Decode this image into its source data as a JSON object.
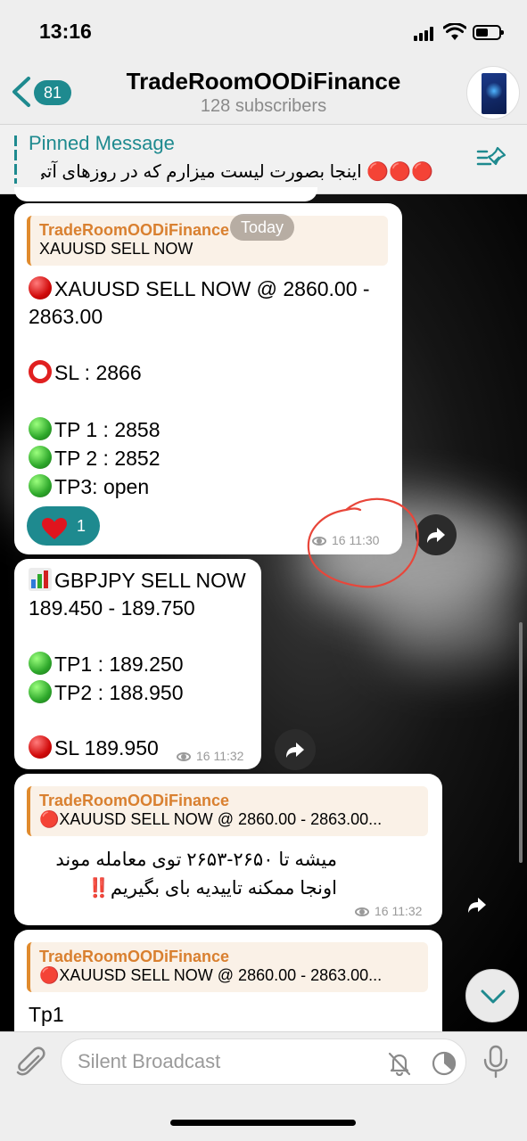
{
  "status_bar": {
    "time": "13:16"
  },
  "header": {
    "back_count": "81",
    "channel_title": "TradeRoomOODiFinance",
    "subscribers": "128 subscribers"
  },
  "pinned": {
    "title": "Pinned Message",
    "text": "🔴🔴🔴 اینجا بصورت لیست میزارم که در روزهای آتی"
  },
  "date_pill": "Today",
  "messages": [
    {
      "reply_name": "TradeRoomOODiFinance",
      "reply_text": "XAUUSD SELL NOW",
      "lines": [
        "XAUUSD SELL NOW @ 2860.00 -",
        "2863.00",
        "SL : 2866",
        "TP 1 : 2858",
        "TP 2 : 2852",
        "TP3: open"
      ],
      "reaction_count": "1",
      "meta": "16 11:30"
    },
    {
      "lines": [
        "GBPJPY SELL NOW",
        "189.450 - 189.750",
        "TP1 : 189.250",
        "TP2 : 188.950",
        "SL 189.950"
      ],
      "meta": "16 11:32"
    },
    {
      "reply_name": "TradeRoomOODiFinance",
      "reply_text": "🔴XAUUSD SELL NOW @ 2860.00 - 2863.00...",
      "lines": [
        "میشه تا ۲۶۵۰-۲۶۵۳ توی معامله موند",
        "اونجا ممکنه تاییدیه بای بگیریم‼️"
      ],
      "meta": "16 11:32"
    },
    {
      "reply_name": "TradeRoomOODiFinance",
      "reply_text": "🔴XAUUSD SELL NOW @ 2860.00 - 2863.00...",
      "lines": [
        "Tp1"
      ]
    }
  ],
  "composer": {
    "placeholder": "Silent Broadcast"
  },
  "colors": {
    "accent": "#1e8a8f",
    "reply_accent": "#e08a2c",
    "annotation": "#e8463a"
  },
  "icons": [
    "back-chevron-icon",
    "pin-list-icon",
    "heart-icon",
    "eye-icon",
    "forward-icon",
    "chevron-down-icon",
    "paperclip-icon",
    "bell-off-icon",
    "timer-icon",
    "microphone-icon"
  ]
}
